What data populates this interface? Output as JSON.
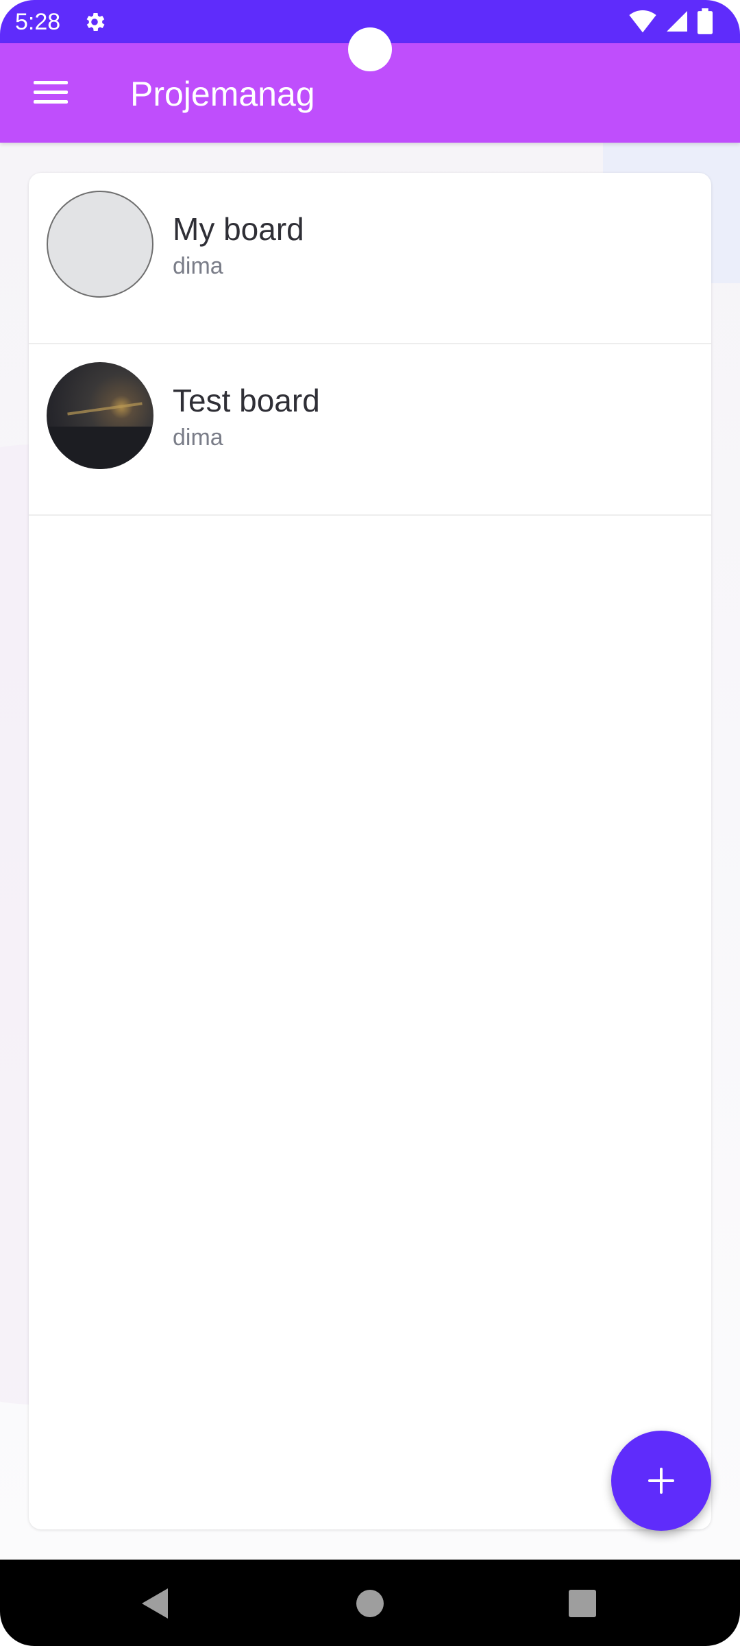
{
  "status_bar": {
    "time": "5:28",
    "icons": [
      "settings-icon",
      "wifi-icon",
      "signal-icon",
      "battery-icon"
    ]
  },
  "app_bar": {
    "title": "Projemanag",
    "menu_icon": "menu-icon"
  },
  "boards": [
    {
      "name": "My board",
      "owner": "dima",
      "avatar": "empty-avatar"
    },
    {
      "name": "Test board",
      "owner": "dima",
      "avatar": "photo-avatar"
    }
  ],
  "fab": {
    "icon": "plus-icon"
  },
  "nav_bar": {
    "buttons": [
      "back-icon",
      "home-icon",
      "recents-icon"
    ]
  },
  "colors": {
    "status_bar": "#5f2cfb",
    "app_bar": "#bf4efc",
    "fab": "#5f2cfb",
    "board_name": "#2f2f36",
    "board_owner": "#7a7d88"
  }
}
